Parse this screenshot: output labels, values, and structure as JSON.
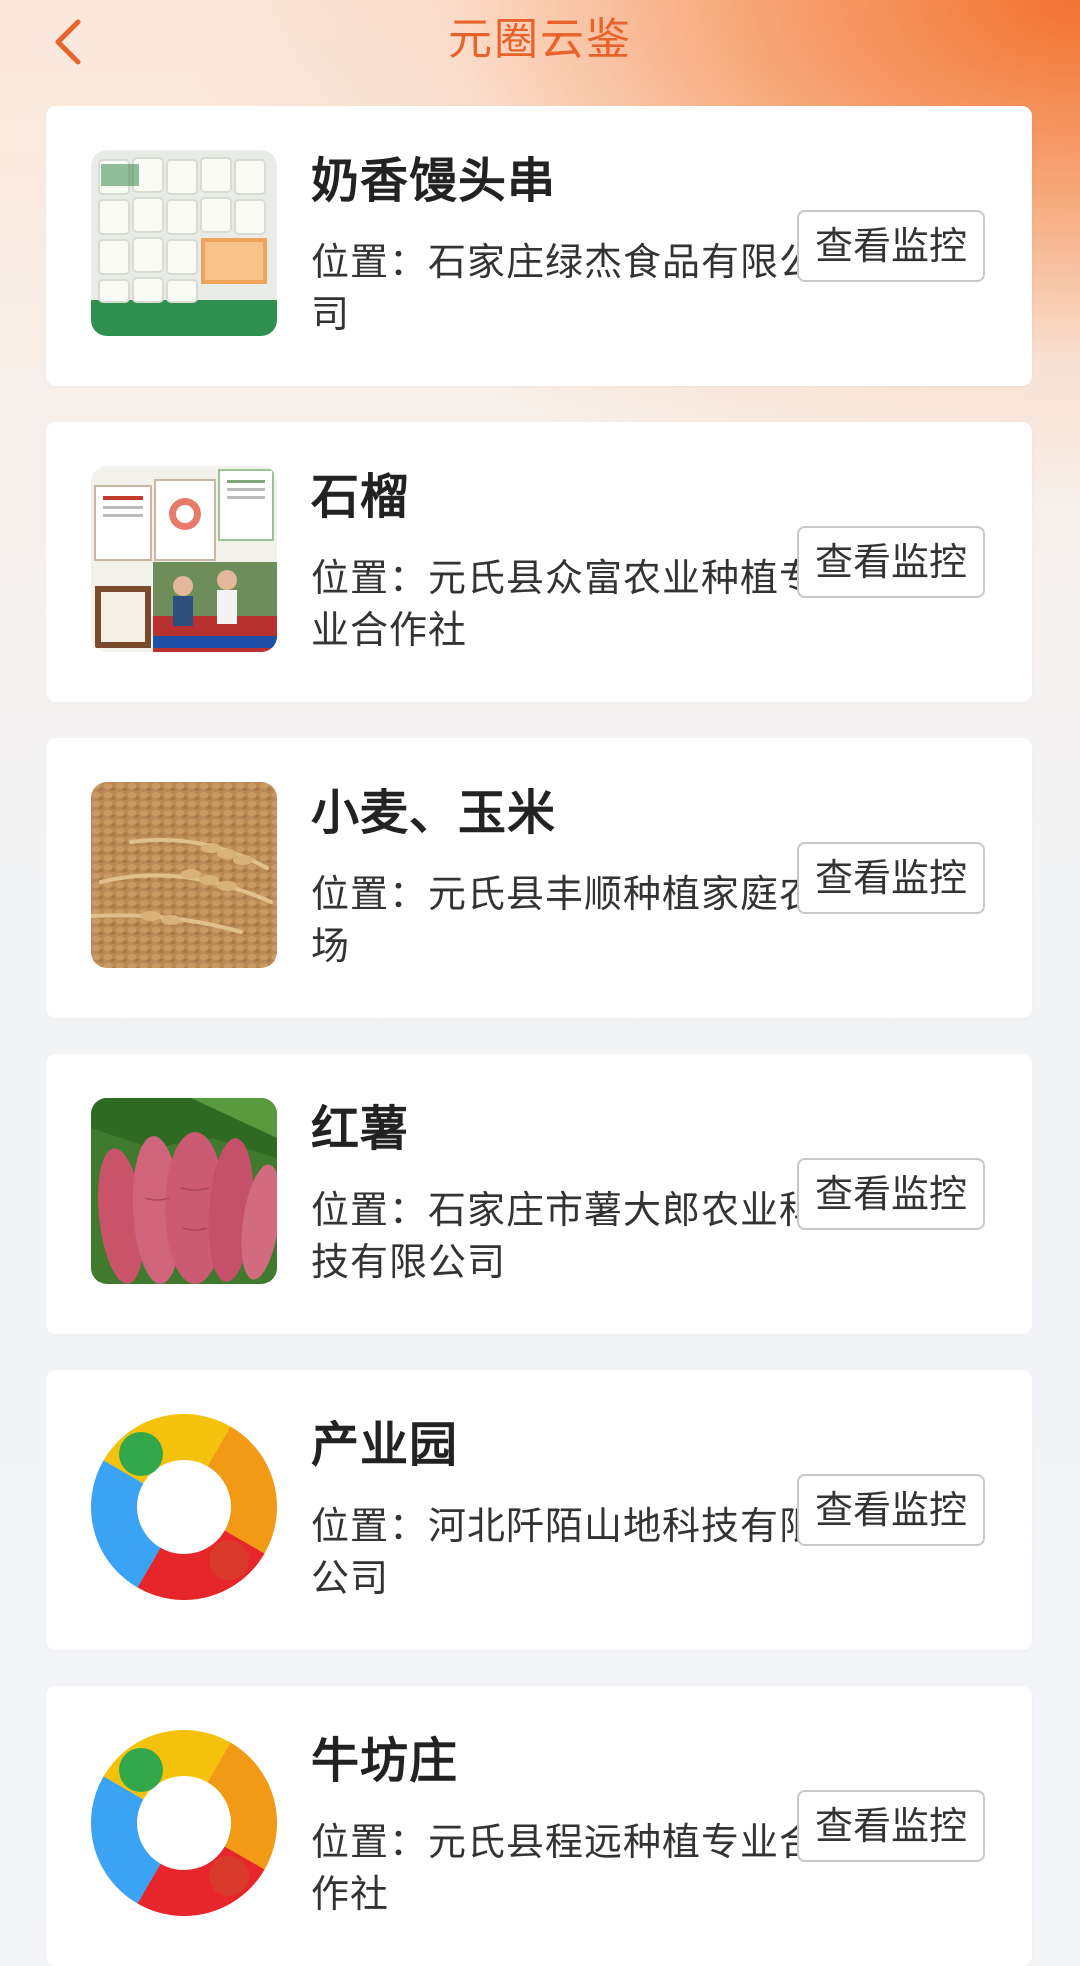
{
  "header": {
    "title": "元圈云鉴",
    "back_icon": "chevron-left-icon",
    "accent_color": "#e8632b"
  },
  "items": [
    {
      "name": "奶香馒头串",
      "location": "位置：石家庄绿杰食品有限公司",
      "button": "查看监控",
      "image": "steamed-bun-photo"
    },
    {
      "name": "石榴",
      "location": "位置：元氏县众富农业种植专业合作社",
      "button": "查看监控",
      "image": "certificates-photo"
    },
    {
      "name": "小麦、玉米",
      "location": "位置：元氏县丰顺种植家庭农场",
      "button": "查看监控",
      "image": "wheat-photo"
    },
    {
      "name": "红薯",
      "location": "位置：石家庄市薯大郎农业科技有限公司",
      "button": "查看监控",
      "image": "sweet-potato-photo"
    },
    {
      "name": "产业园",
      "location": "位置：河北阡陌山地科技有限公司",
      "button": "查看监控",
      "image": "ring-logo"
    },
    {
      "name": "牛坊庄",
      "location": "位置：元氏县程远种植专业合作社",
      "button": "查看监控",
      "image": "ring-logo"
    }
  ]
}
